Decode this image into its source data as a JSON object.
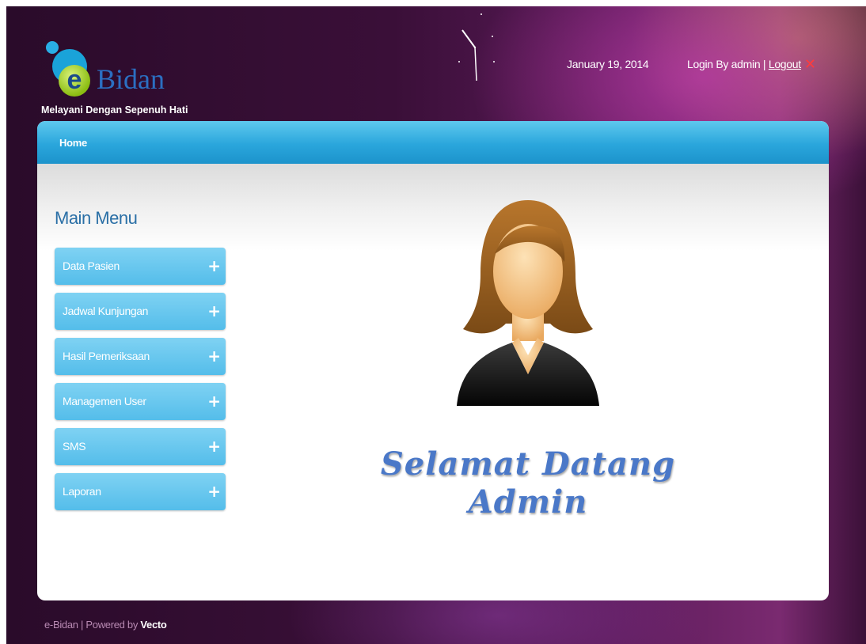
{
  "header": {
    "logo_letter": "e",
    "logo_name": "Bidan",
    "tagline": "Melayani Dengan Sepenuh Hati",
    "date": "January 19, 2014",
    "login_text": "Login By admin |",
    "logout_label": "Logout",
    "logout_icon": "close-icon"
  },
  "nav": {
    "home_label": "Home"
  },
  "sidebar": {
    "title": "Main Menu",
    "items": [
      {
        "label": "Data Pasien",
        "icon": "+"
      },
      {
        "label": "Jadwal Kunjungan",
        "icon": "+"
      },
      {
        "label": "Hasil Pemeriksaan",
        "icon": "+"
      },
      {
        "label": "Managemen User",
        "icon": "+"
      },
      {
        "label": "SMS",
        "icon": "+"
      },
      {
        "label": "Laporan",
        "icon": "+"
      }
    ]
  },
  "main": {
    "welcome_text": "Selamat Datang Admin"
  },
  "footer": {
    "prefix": "e-Bidan | Powered by",
    "brand": "Vecto"
  },
  "colors": {
    "nav_blue": "#2aa6dc",
    "menu_blue": "#54bdea",
    "background_purple": "#3a0f38",
    "welcome_blue": "#4a78c8"
  }
}
